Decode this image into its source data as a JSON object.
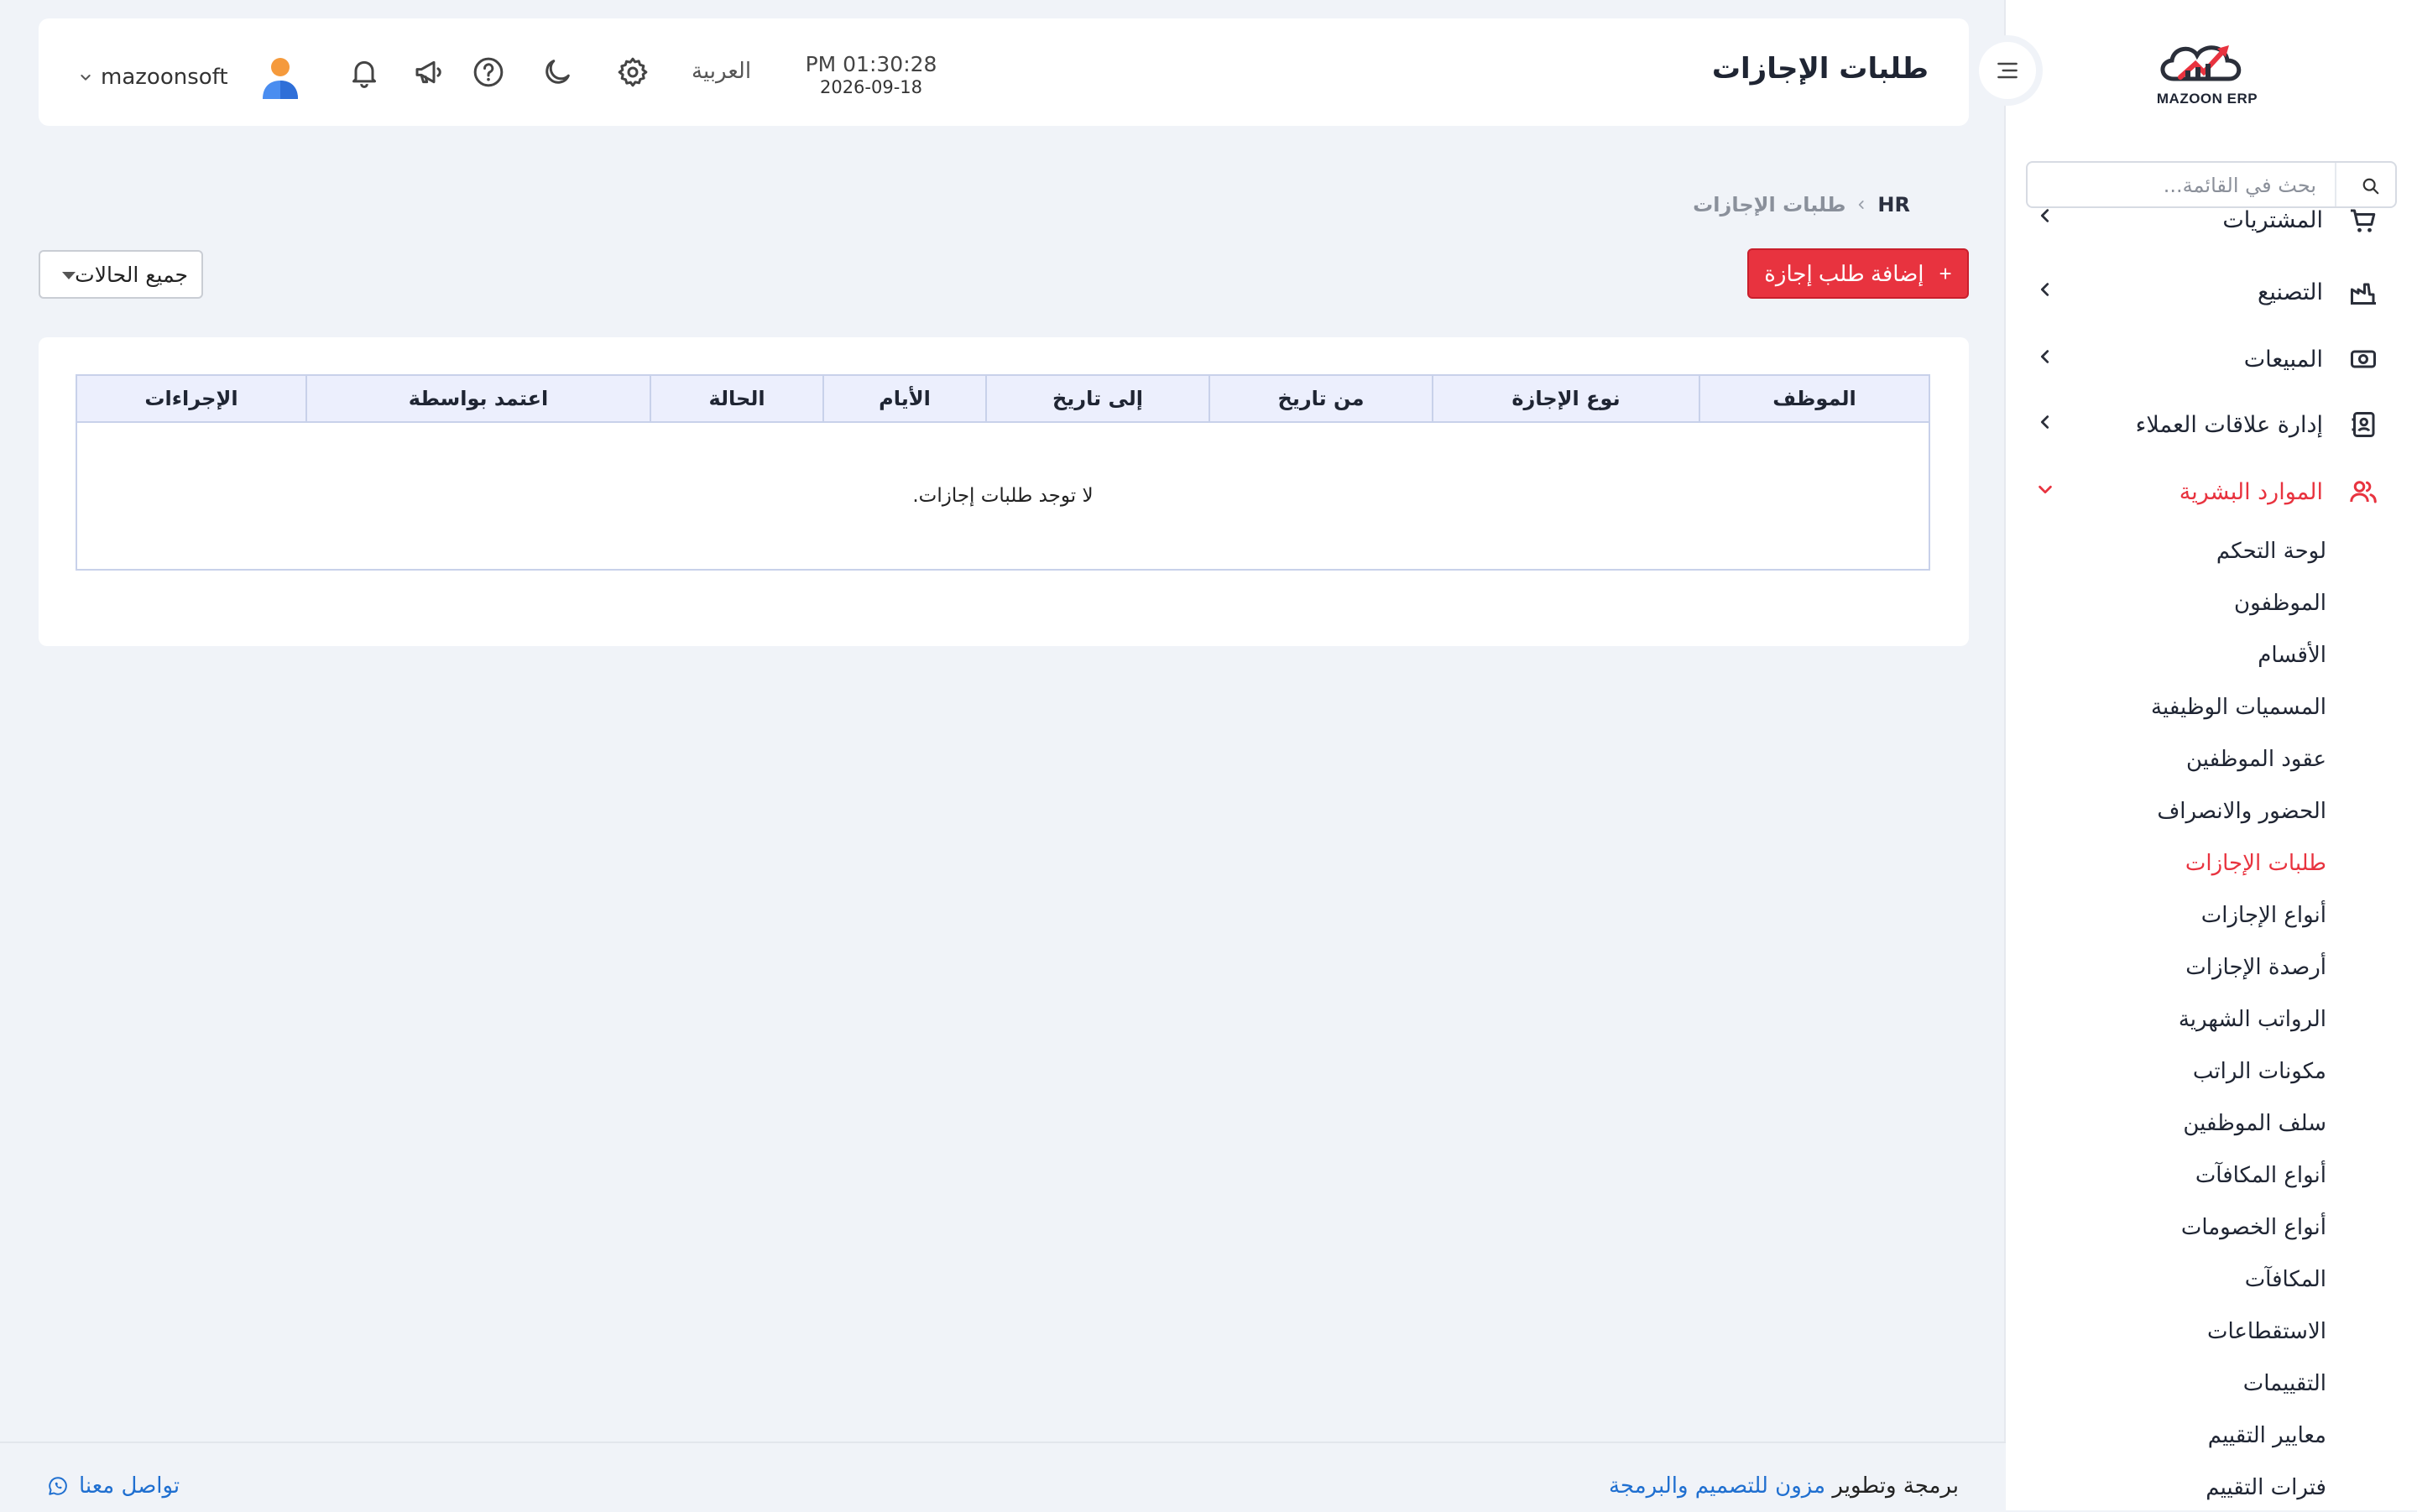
{
  "brand": {
    "logo_text": "MAZOON ERP"
  },
  "sidebar": {
    "search_placeholder": "بحث في القائمة...",
    "modules": [
      {
        "label": "المشتريات"
      },
      {
        "label": "التصنيع"
      },
      {
        "label": "المبيعات"
      },
      {
        "label": "إدارة علاقات العملاء"
      },
      {
        "label": "الموارد البشرية"
      }
    ],
    "hr_items": [
      "لوحة التحكم",
      "الموظفون",
      "الأقسام",
      "المسميات الوظيفية",
      "عقود الموظفين",
      "الحضور والانصراف",
      "طلبات الإجازات",
      "أنواع الإجازات",
      "أرصدة الإجازات",
      "الرواتب الشهرية",
      "مكونات الراتب",
      "سلف الموظفين",
      "أنواع المكافآت",
      "أنواع الخصومات",
      "المكافآت",
      "الاستقطاعات",
      "التقييمات",
      "معايير التقييم",
      "فترات التقييم"
    ]
  },
  "header": {
    "title": "طلبات الإجازات",
    "time": "PM 01:30:28",
    "date": "2026-09-18",
    "language": "العربية",
    "username": "mazoonsoft"
  },
  "breadcrumb": {
    "root": "HR",
    "current": "طلبات الإجازات"
  },
  "actions": {
    "add_label": "إضافة طلب إجازة",
    "plus": "+",
    "filter_label": "جميع الحالات"
  },
  "table": {
    "columns": [
      "الموظف",
      "نوع الإجازة",
      "من تاريخ",
      "إلى تاريخ",
      "الأيام",
      "الحالة",
      "اعتمد بواسطة",
      "الإجراءات"
    ],
    "empty_message": "لا توجد طلبات إجازات."
  },
  "footer": {
    "credit_prefix": "برمجة وتطوير",
    "company": "مزون للتصميم والبرمجة",
    "contact": "تواصل معنا"
  },
  "colors": {
    "accent": "#e8333f",
    "link": "#1f6fd0",
    "background": "#f0f3f8"
  }
}
